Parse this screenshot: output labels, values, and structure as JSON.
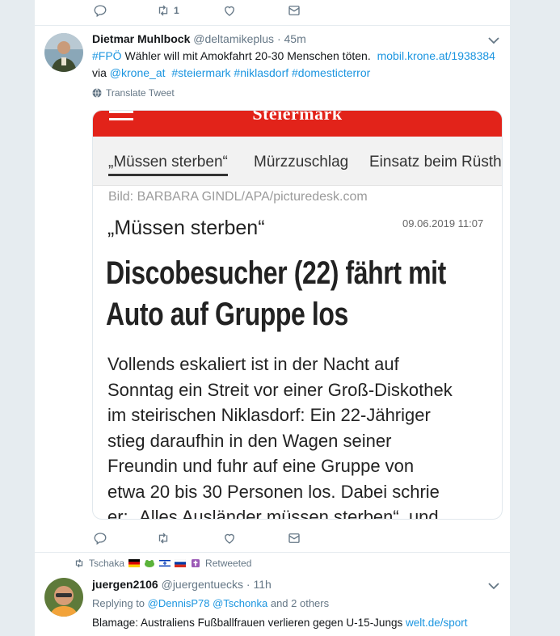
{
  "colors": {
    "accent": "#1b95e0",
    "muted": "#657786",
    "krone_red": "#e2231a",
    "border": "#e6ecf0"
  },
  "tweet_top": {
    "retweet_count": "1",
    "icons": [
      "reply-icon",
      "retweet-icon",
      "like-icon",
      "dm-icon"
    ]
  },
  "tweet1": {
    "display_name": "Dietmar Muhlbock",
    "handle": "@deltamikeplus",
    "dot": "·",
    "time": "45m",
    "hashtag_fpo": "#FPÖ",
    "text_main": "Wähler will mit Amokfahrt 20-30 Menschen töten.",
    "link": "mobil.krone.at/1938384",
    "via": "via",
    "mention_krone": "@krone_at",
    "tag_steiermark": "#steiermark",
    "tag_niklasdorf": "#niklasdorf",
    "tag_domesticterror": "#domesticterror",
    "translate": "Translate Tweet",
    "card": {
      "brand": "Steiermark",
      "nav": [
        "„Müssen sterben“",
        "Mürzzuschlag",
        "Einsatz beim Rüsth"
      ],
      "credit": "Bild: BARBARA GINDL/APA/picturedesk.com",
      "kicker": "„Müssen sterben“",
      "date": "09.06.2019 11:07",
      "headline": [
        "Discobesucher (22) fährt mit",
        "Auto auf Gruppe los"
      ],
      "body": [
        "Vollends eskaliert ist in der Nacht auf",
        "Sonntag ein Streit vor einer Groß-Diskothek",
        "im steirischen Niklasdorf: Ein 22-Jähriger",
        "stieg daraufhin in den Wagen seiner",
        "Freundin und fuhr auf eine Gruppe von",
        "etwa 20 bis 30 Personen los. Dabei schrie",
        "er: „Alles Ausländer müssen sterben“, und"
      ]
    }
  },
  "retweet_bar": {
    "user": "Tschaka",
    "label": "Retweeted"
  },
  "tweet2": {
    "display_name": "juergen2106",
    "handle": "@juergentuecks",
    "dot": "·",
    "time": "11h",
    "replying_to": "Replying to",
    "reply_user1": "@DennisP78",
    "reply_user2": "@Tschonka",
    "and_others": "and 2 others",
    "text": "Blamage: Australiens Fußballfrauen verlieren gegen U-15-Jungs",
    "link": "welt.de/sport"
  }
}
